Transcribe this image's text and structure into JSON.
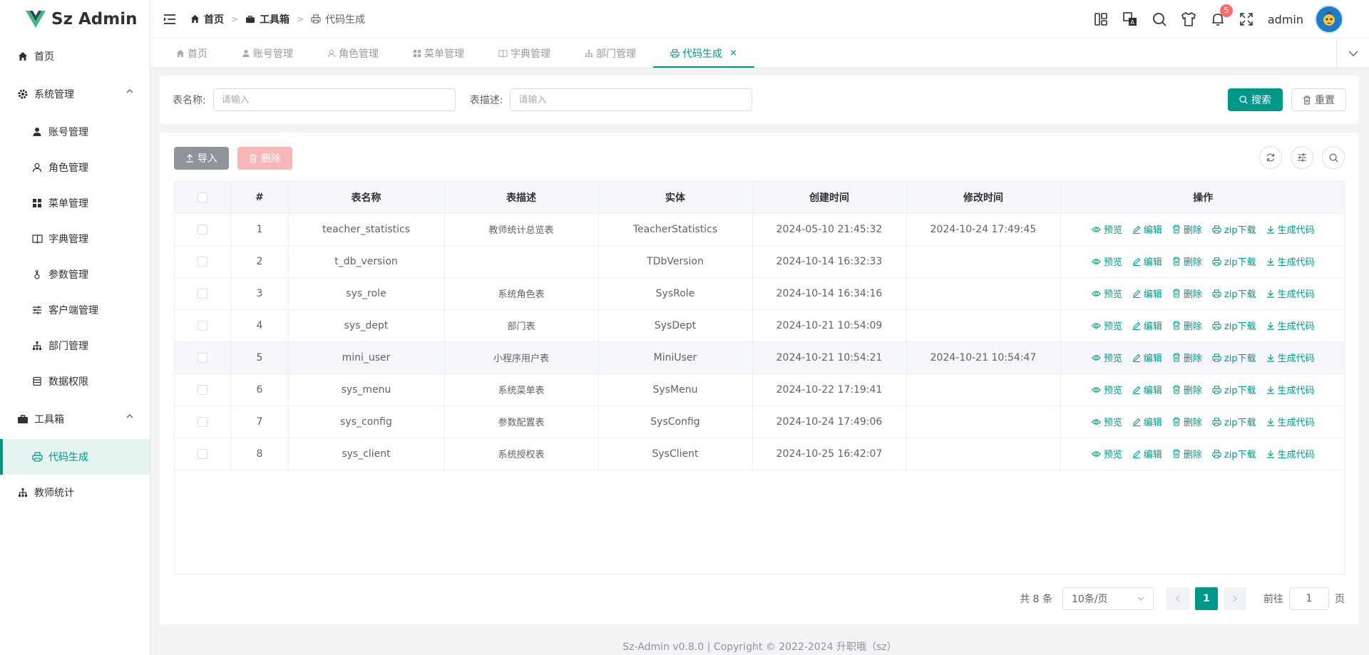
{
  "app": {
    "title": "Sz Admin"
  },
  "sidebar": {
    "items": [
      {
        "label": "首页"
      },
      {
        "label": "系统管理"
      },
      {
        "label": "账号管理"
      },
      {
        "label": "角色管理"
      },
      {
        "label": "菜单管理"
      },
      {
        "label": "字典管理"
      },
      {
        "label": "参数管理"
      },
      {
        "label": "客户端管理"
      },
      {
        "label": "部门管理"
      },
      {
        "label": "数据权限"
      },
      {
        "label": "工具箱"
      },
      {
        "label": "代码生成"
      },
      {
        "label": "教师统计"
      }
    ]
  },
  "breadcrumb": {
    "home": "首页",
    "toolbox": "工具箱",
    "current": "代码生成"
  },
  "header": {
    "notification_count": "5",
    "username": "admin"
  },
  "tabs": [
    {
      "label": "首页"
    },
    {
      "label": "账号管理"
    },
    {
      "label": "角色管理"
    },
    {
      "label": "菜单管理"
    },
    {
      "label": "字典管理"
    },
    {
      "label": "部门管理"
    },
    {
      "label": "代码生成",
      "close": "×"
    }
  ],
  "search": {
    "table_name_label": "表名称:",
    "table_name_placeholder": "请输入",
    "table_desc_label": "表描述:",
    "table_desc_placeholder": "请输入",
    "search_button": "搜索",
    "reset_button": "重置"
  },
  "toolbar": {
    "import_button": "导入",
    "delete_button": "删除"
  },
  "table": {
    "columns": [
      "#",
      "表名称",
      "表描述",
      "实体",
      "创建时间",
      "修改时间",
      "操作"
    ],
    "ops": {
      "preview": "预览",
      "edit": "编辑",
      "delete": "删除",
      "zip": "zip下载",
      "gen": "生成代码"
    },
    "rows": [
      {
        "no": "1",
        "name": "teacher_statistics",
        "desc": "教师统计总览表",
        "entity": "TeacherStatistics",
        "created": "2024-05-10 21:45:32",
        "updated": "2024-10-24 17:49:45"
      },
      {
        "no": "2",
        "name": "t_db_version",
        "desc": "",
        "entity": "TDbVersion",
        "created": "2024-10-14 16:32:33",
        "updated": ""
      },
      {
        "no": "3",
        "name": "sys_role",
        "desc": "系统角色表",
        "entity": "SysRole",
        "created": "2024-10-14 16:34:16",
        "updated": ""
      },
      {
        "no": "4",
        "name": "sys_dept",
        "desc": "部门表",
        "entity": "SysDept",
        "created": "2024-10-21 10:54:09",
        "updated": ""
      },
      {
        "no": "5",
        "name": "mini_user",
        "desc": "小程序用户表",
        "entity": "MiniUser",
        "created": "2024-10-21 10:54:21",
        "updated": "2024-10-21 10:54:47"
      },
      {
        "no": "6",
        "name": "sys_menu",
        "desc": "系统菜单表",
        "entity": "SysMenu",
        "created": "2024-10-22 17:19:41",
        "updated": ""
      },
      {
        "no": "7",
        "name": "sys_config",
        "desc": "参数配置表",
        "entity": "SysConfig",
        "created": "2024-10-24 17:49:06",
        "updated": ""
      },
      {
        "no": "8",
        "name": "sys_client",
        "desc": "系统授权表",
        "entity": "SysClient",
        "created": "2024-10-25 16:42:07",
        "updated": ""
      }
    ]
  },
  "pagination": {
    "total": "共 8 条",
    "page_size": "10条/页",
    "current": "1",
    "goto_label": "前往",
    "goto_value": "1",
    "page_label": "页"
  },
  "footer": {
    "text": "Sz-Admin v0.8.0 | Copyright © 2022-2024 升职哦（sz）"
  },
  "colors": {
    "primary": "#009688",
    "danger": "#f56c6c",
    "sidebar_active_bg": "#e6f4f1"
  }
}
